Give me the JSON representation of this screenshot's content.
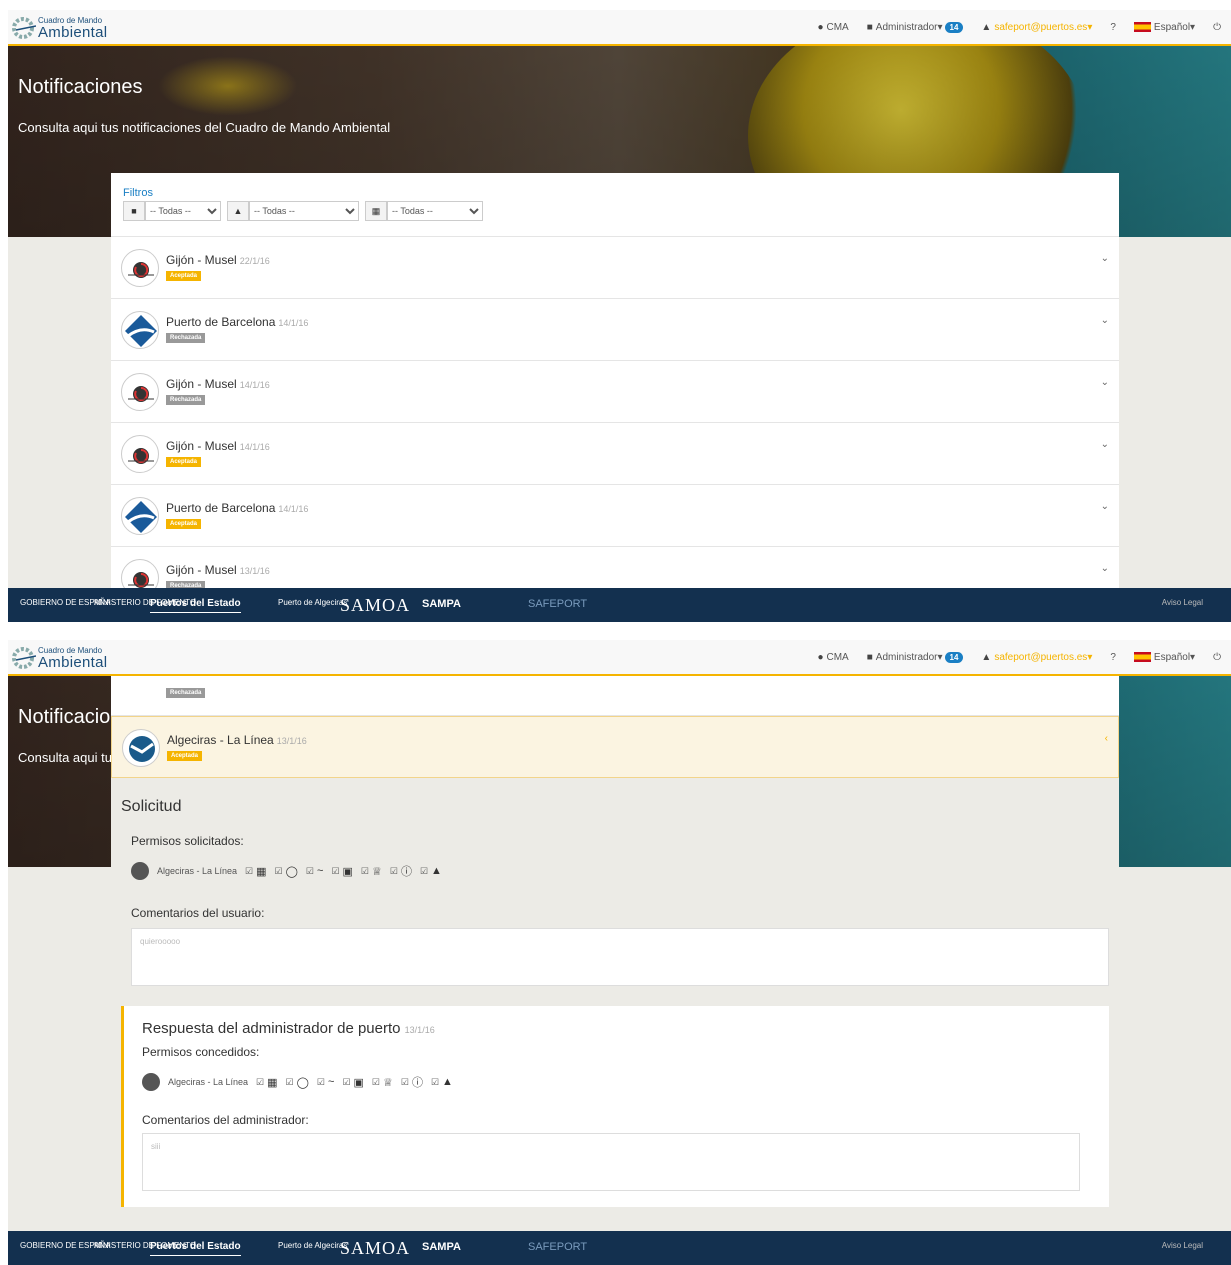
{
  "brand": {
    "small": "Cuadro de Mando",
    "big": "Ambiental"
  },
  "nav": {
    "cma": "CMA",
    "admin": "Administrador",
    "admin_count": "14",
    "user": "safeport@puertos.es",
    "help": "?",
    "lang": "Español"
  },
  "hero": {
    "title": "Notificaciones",
    "subtitle": "Consulta aqui tus notificaciones del Cuadro de Mando Ambiental"
  },
  "filters": {
    "label": "Filtros",
    "select1": "-- Todas --",
    "select2": "-- Todas --",
    "select3": "-- Todas --"
  },
  "notifications": [
    {
      "port": "Gijón - Musel",
      "date": "22/1/16",
      "status": "Aceptada"
    },
    {
      "port": "Puerto de Barcelona",
      "date": "14/1/16",
      "status": "Rechazada"
    },
    {
      "port": "Gijón - Musel",
      "date": "14/1/16",
      "status": "Rechazada"
    },
    {
      "port": "Gijón - Musel",
      "date": "14/1/16",
      "status": "Aceptada"
    },
    {
      "port": "Puerto de Barcelona",
      "date": "14/1/16",
      "status": "Aceptada"
    },
    {
      "port": "Gijón - Musel",
      "date": "13/1/16",
      "status": "Rechazada"
    }
  ],
  "detail": {
    "prev_status": "Rechazada",
    "port": "Algeciras - La Línea",
    "date": "13/1/16",
    "status": "Aceptada",
    "solicitud": "Solicitud",
    "permisos_solicitados": "Permisos solicitados:",
    "perm_port": "Algeciras - La Línea",
    "comentarios_usuario_label": "Comentarios del usuario:",
    "comentario_usuario": "quierooooo",
    "respuesta_title": "Respuesta del administrador de puerto",
    "respuesta_date": "13/1/16",
    "permisos_concedidos": "Permisos concedidos:",
    "comentarios_admin_label": "Comentarios del administrador:",
    "comentario_admin": "siii"
  },
  "footer": {
    "gobierno": "GOBIERNO DE ESPAÑA",
    "ministerio": "MINISTERIO DE FOMENTO",
    "puertos": "Puertos del Estado",
    "algeciras": "Puerto de Algeciras",
    "samoa": "SAMOA",
    "sampa": "SAMPA",
    "safeport": "SAFEPORT",
    "aviso": "Aviso Legal"
  },
  "colors": {
    "accent": "#f5b400",
    "primary": "#1a7fc4",
    "footer": "#13304f"
  }
}
